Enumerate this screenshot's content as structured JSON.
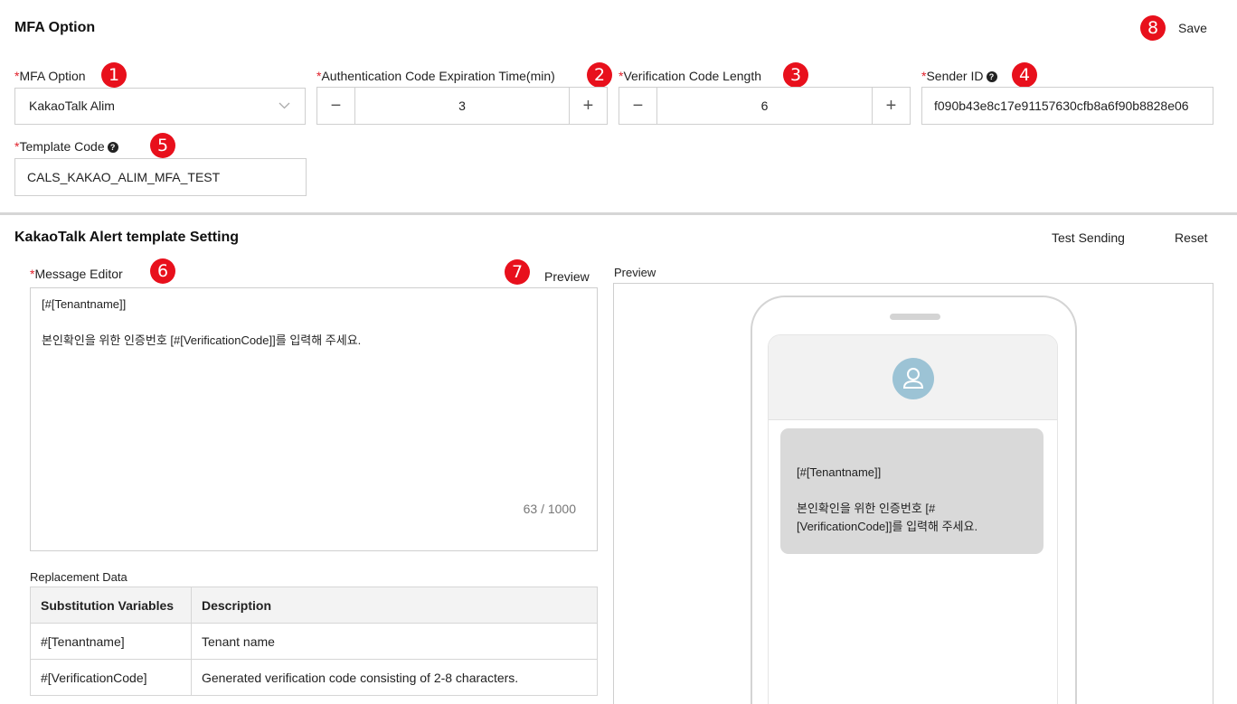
{
  "header": {
    "title": "MFA Option",
    "save_label": "Save"
  },
  "markers": [
    "1",
    "2",
    "3",
    "4",
    "5",
    "6",
    "7",
    "8"
  ],
  "mfa": {
    "option_label": "MFA Option",
    "option_value": "KakaoTalk Alim",
    "expiration_label": "Authentication Code Expiration Time(min)",
    "expiration_value": "3",
    "length_label": "Verification Code Length",
    "length_value": "6",
    "sender_label": "Sender ID",
    "sender_value": "f090b43e8c17e91157630cfb8a6f90b8828e06",
    "template_label": "Template Code",
    "template_value": "CALS_KAKAO_ALIM_MFA_TEST",
    "required_mark": "*",
    "minus": "−",
    "plus": "+",
    "help": "?"
  },
  "template": {
    "title": "KakaoTalk Alert template Setting",
    "test_sending_label": "Test Sending",
    "reset_label": "Reset",
    "editor_label": "Message Editor",
    "preview_button_label": "Preview",
    "preview_label": "Preview",
    "message": "[#[Tenantname]]\n\n본인확인을 위한 인증번호 [#[VerificationCode]]를 입력해 주세요.",
    "counter": "63 / 1000",
    "bubble_text": "[#[Tenantname]]\n\n본인확인을 위한 인증번호 [#\n[VerificationCode]]를 입력해 주세요."
  },
  "replacement": {
    "title": "Replacement Data",
    "headers": [
      "Substitution Variables",
      "Description"
    ],
    "rows": [
      [
        "#[Tenantname]",
        "Tenant name"
      ],
      [
        "#[VerificationCode]",
        "Generated verification code consisting of 2-8 characters."
      ]
    ]
  },
  "colors": {
    "marker": "#e8101c",
    "required": "#e0202a",
    "avatar": "#9cc3d5"
  }
}
